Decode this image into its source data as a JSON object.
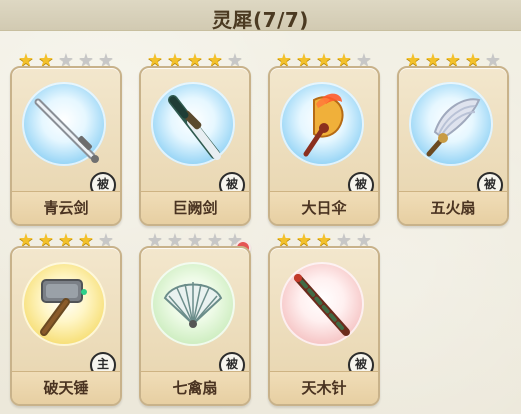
{
  "header": {
    "title": "灵犀(7/7)"
  },
  "cards": [
    {
      "name": "青云剑",
      "badge": "被",
      "stars_on": 2,
      "stars_total": 5,
      "icon": "sword-icon",
      "circle": "blue"
    },
    {
      "name": "巨阙剑",
      "badge": "被",
      "stars_on": 4,
      "stars_total": 5,
      "icon": "greatsword-icon",
      "circle": "blue"
    },
    {
      "name": "大日伞",
      "badge": "被",
      "stars_on": 4,
      "stars_total": 5,
      "icon": "sun-umbrella-icon",
      "circle": "blue"
    },
    {
      "name": "五火扇",
      "badge": "被",
      "stars_on": 4,
      "stars_total": 5,
      "icon": "feather-fan-icon",
      "circle": "blue"
    },
    {
      "name": "破天锤",
      "badge": "主",
      "stars_on": 4,
      "stars_total": 5,
      "icon": "hammer-icon",
      "circle": "yellow"
    },
    {
      "name": "七禽扇",
      "badge": "被",
      "stars_on": 0,
      "stars_total": 5,
      "icon": "folding-fan-icon",
      "circle": "green",
      "notification": true
    },
    {
      "name": "天木针",
      "badge": "被",
      "stars_on": 3,
      "stars_total": 5,
      "icon": "needle-icon",
      "circle": "red"
    }
  ]
}
